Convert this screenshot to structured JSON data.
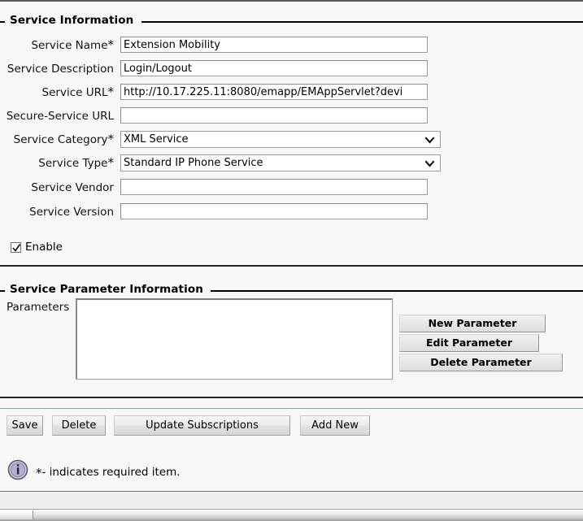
{
  "service_information": {
    "legend": "Service Information",
    "fields": [
      {
        "label": "Service Name",
        "required": true,
        "type": "text",
        "value": "Extension Mobility",
        "placeholder": ""
      },
      {
        "label": "Service Description",
        "required": false,
        "type": "text",
        "value": "Login/Logout",
        "placeholder": ""
      },
      {
        "label": "Service URL",
        "required": true,
        "type": "text",
        "value": "http://10.17.225.11:8080/emapp/EMAppServlet?devi",
        "placeholder": ""
      },
      {
        "label": "Secure-Service URL",
        "required": false,
        "type": "text",
        "value": "",
        "placeholder": ""
      },
      {
        "label": "Service Category",
        "required": true,
        "type": "select",
        "value": "XML Service",
        "placeholder": ""
      },
      {
        "label": "Service Type",
        "required": true,
        "type": "select",
        "value": "Standard IP Phone Service",
        "placeholder": ""
      },
      {
        "label": "Service Vendor",
        "required": false,
        "type": "text",
        "value": "",
        "placeholder": ""
      },
      {
        "label": "Service Version",
        "required": false,
        "type": "text",
        "value": "",
        "placeholder": ""
      }
    ],
    "enable_checkbox": {
      "label": "Enable",
      "checked": true
    }
  },
  "service_parameter_information": {
    "legend": "Service Parameter Information",
    "parameters_label": "Parameters",
    "parameters_items": [],
    "buttons": [
      {
        "label": "New Parameter"
      },
      {
        "label": "Edit Parameter"
      },
      {
        "label": "Delete Parameter"
      }
    ]
  },
  "action_bar": {
    "buttons": [
      {
        "label": "Save"
      },
      {
        "label": "Delete"
      },
      {
        "label": "Update Subscriptions"
      },
      {
        "label": "Add New"
      }
    ]
  },
  "footer_note": {
    "icon": "info-icon",
    "star": "*",
    "text": "- indicates required item."
  },
  "colors": {
    "page_background": "#f7f7f5",
    "rule": "#222222",
    "thin_rule": "#8fa3a3",
    "input_border": "#9a9a9a",
    "info_icon_fill": "#b9b7d6"
  }
}
